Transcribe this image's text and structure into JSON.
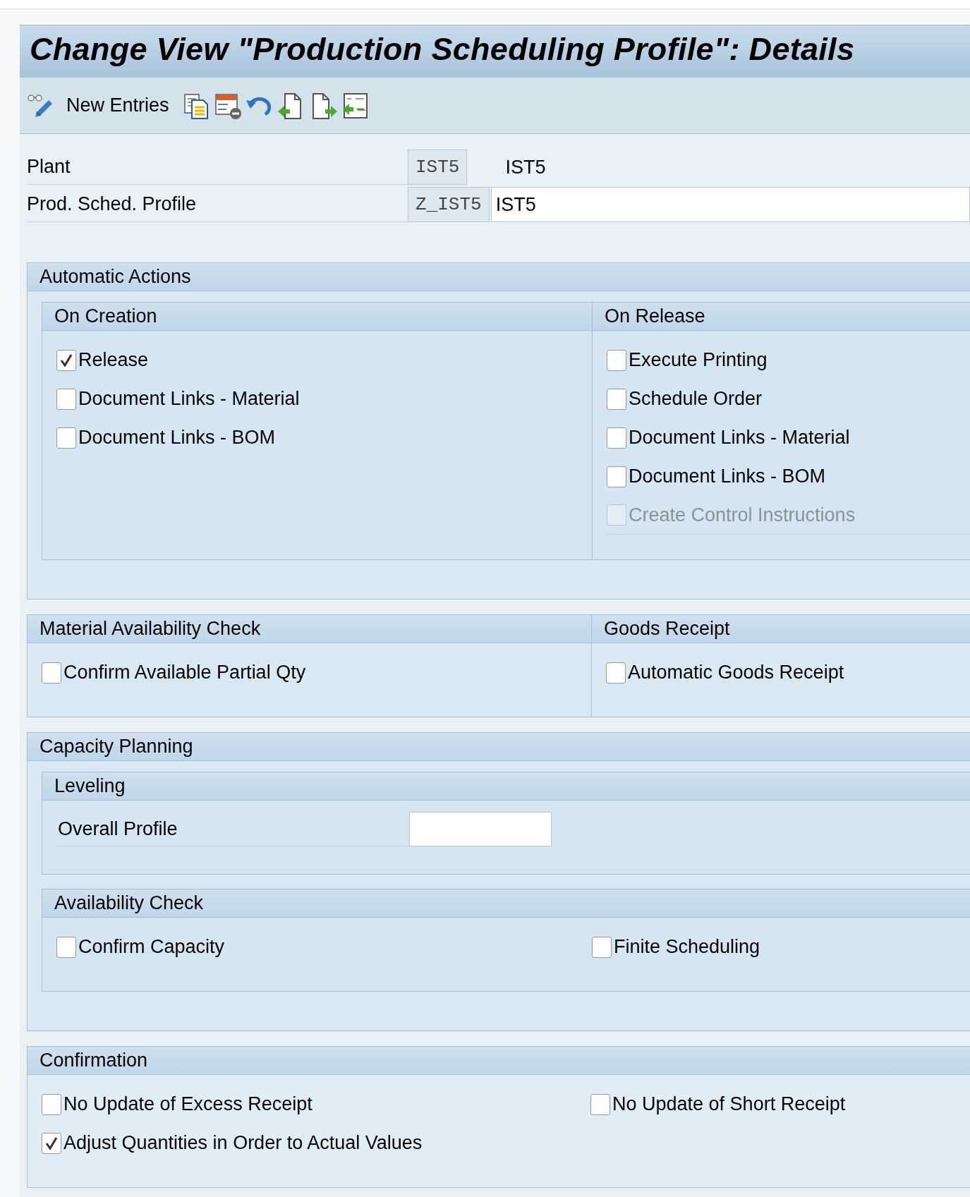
{
  "title": "Change View \"Production Scheduling Profile\": Details",
  "toolbar": {
    "new_entries": "New Entries"
  },
  "header_fields": [
    {
      "label": "Plant",
      "value": "IST5",
      "description": "IST5",
      "kind": "text"
    },
    {
      "label": "Prod. Sched. Profile",
      "value": "Z_IST5",
      "description": "IST5",
      "kind": "field"
    }
  ],
  "sections": [
    {
      "kind": "nested_row",
      "title": "Automatic Actions",
      "subgroups": [
        {
          "title": "On Creation",
          "columns": [
            [
              {
                "label": "Release",
                "checked": true,
                "disabled": false
              },
              {
                "label": "Document Links - Material",
                "checked": false,
                "disabled": false
              },
              {
                "label": "Document Links - BOM",
                "checked": false,
                "disabled": false
              }
            ]
          ]
        },
        {
          "title": "On Release",
          "columns": [
            [
              {
                "label": "Execute Printing",
                "checked": false,
                "disabled": false
              },
              {
                "label": "Schedule Order",
                "checked": false,
                "disabled": false
              },
              {
                "label": "Document Links - Material",
                "checked": false,
                "disabled": false
              },
              {
                "label": "Document Links - BOM",
                "checked": false,
                "disabled": false
              },
              {
                "label": "Create Control Instructions",
                "checked": false,
                "disabled": true
              }
            ]
          ]
        }
      ]
    },
    {
      "kind": "split",
      "groups": [
        {
          "title": "Material Availability Check",
          "columns": [
            [
              {
                "label": "Confirm Available Partial Qty",
                "checked": false,
                "disabled": false
              }
            ]
          ]
        },
        {
          "title": "Goods Receipt",
          "columns": [
            [
              {
                "label": "Automatic Goods Receipt",
                "checked": false,
                "disabled": false
              }
            ]
          ]
        }
      ]
    },
    {
      "kind": "nested_stack",
      "title": "Capacity Planning",
      "subgroups": [
        {
          "title": "Leveling",
          "fields": [
            {
              "label": "Overall Profile"
            }
          ]
        },
        {
          "title": "Availability Check",
          "columns": [
            [
              {
                "label": "Confirm Capacity",
                "checked": false,
                "disabled": false
              }
            ],
            [
              {
                "label": "Finite Scheduling",
                "checked": false,
                "disabled": false
              }
            ]
          ]
        }
      ]
    },
    {
      "kind": "plain",
      "title": "Confirmation",
      "columns": [
        [
          {
            "label": "No Update of Excess Receipt",
            "checked": false,
            "disabled": false
          },
          {
            "label": "Adjust Quantities in Order to Actual Values",
            "checked": true,
            "disabled": false
          }
        ],
        [
          {
            "label": "No Update of Short Receipt",
            "checked": false,
            "disabled": false
          }
        ]
      ]
    }
  ]
}
